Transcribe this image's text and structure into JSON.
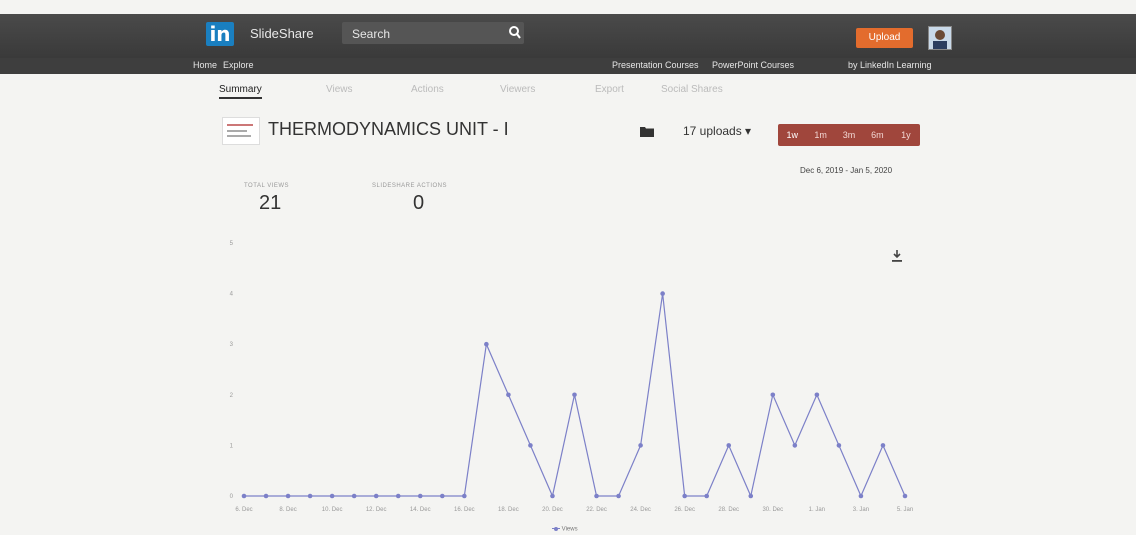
{
  "header": {
    "logo_badge": "in",
    "brand": "SlideShare",
    "search_placeholder": "Search",
    "upload_label": "Upload",
    "nav_left": [
      "Home",
      "Explore"
    ],
    "nav_right": [
      "Presentation Courses",
      "PowerPoint Courses",
      "by LinkedIn Learning"
    ]
  },
  "tabs": [
    "Summary",
    "Views",
    "Actions",
    "Viewers",
    "Export",
    "Social Shares"
  ],
  "active_tab": "Summary",
  "presentation": {
    "title": "THERMODYNAMICS UNIT - I",
    "uploads_label": "17 uploads ▾"
  },
  "ranges": [
    "1w",
    "1m",
    "3m",
    "6m",
    "1y"
  ],
  "date_range": "Dec 6, 2019 - Jan 5, 2020",
  "stats": {
    "total_views_label": "TOTAL VIEWS",
    "total_views": "21",
    "actions_label": "SLIDESHARE ACTIONS",
    "actions": "0"
  },
  "colors": {
    "accent_upload": "#e36c2d",
    "range_group": "#a0463c",
    "series": "#7c80c8"
  },
  "icons": [
    "linkedin-logo",
    "search-icon",
    "avatar",
    "folder-icon",
    "download-icon"
  ],
  "chart_data": {
    "type": "line",
    "x": [
      "6 Dec",
      "7 Dec",
      "8 Dec",
      "9 Dec",
      "10 Dec",
      "11 Dec",
      "12 Dec",
      "13 Dec",
      "14 Dec",
      "15 Dec",
      "16 Dec",
      "17 Dec",
      "18 Dec",
      "19 Dec",
      "20 Dec",
      "21 Dec",
      "22 Dec",
      "23 Dec",
      "24 Dec",
      "25 Dec",
      "26 Dec",
      "27 Dec",
      "28 Dec",
      "29 Dec",
      "30 Dec",
      "31 Dec",
      "1 Jan",
      "2 Jan",
      "3 Jan",
      "4 Jan",
      "5 Jan"
    ],
    "x_tick_labels": [
      "6. Dec",
      "8. Dec",
      "10. Dec",
      "12. Dec",
      "14. Dec",
      "16. Dec",
      "18. Dec",
      "20. Dec",
      "22. Dec",
      "24. Dec",
      "26. Dec",
      "28. Dec",
      "30. Dec",
      "1. Jan",
      "3. Jan",
      "5. Jan"
    ],
    "series": [
      {
        "name": "Views",
        "values": [
          0,
          0,
          0,
          0,
          0,
          0,
          0,
          0,
          0,
          0,
          0,
          3,
          2,
          1,
          0,
          2,
          0,
          0,
          1,
          4,
          0,
          0,
          1,
          0,
          2,
          1,
          2,
          1,
          0,
          1,
          0
        ]
      }
    ],
    "y_ticks": [
      0,
      1,
      2,
      3,
      4,
      5
    ],
    "ylim": [
      0,
      5
    ],
    "legend": "bottom-center",
    "grid": false
  }
}
